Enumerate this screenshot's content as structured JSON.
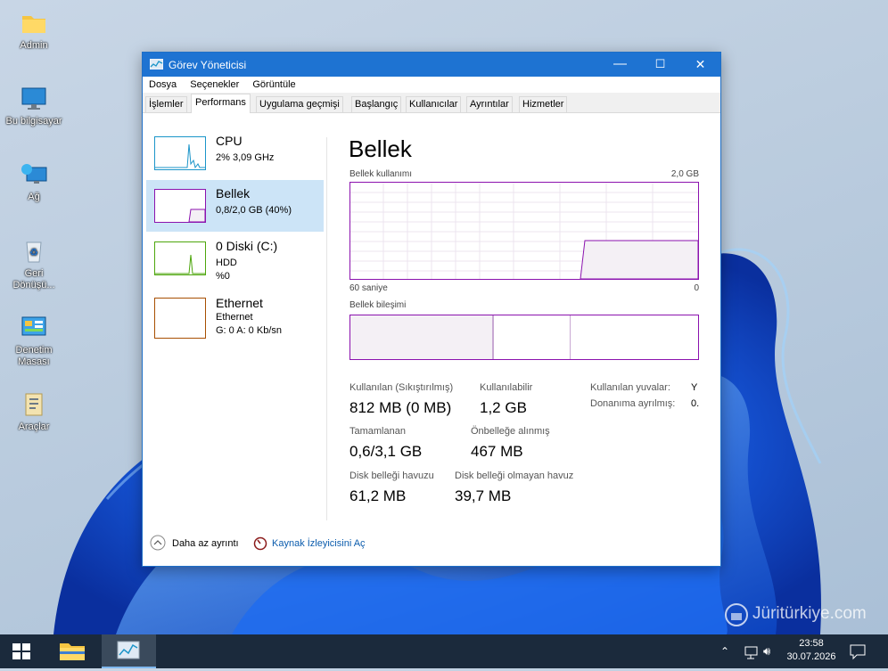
{
  "desktop": {
    "icons": [
      {
        "label": "Admin"
      },
      {
        "label": "Bu bilgisayar"
      },
      {
        "label": "Ağ"
      },
      {
        "label": "Geri Dönüşü..."
      },
      {
        "label": "Denetim Masası"
      },
      {
        "label": "Araçlar"
      }
    ],
    "watermark": "Jüritürkiye.com"
  },
  "window": {
    "title": "Görev Yöneticisi",
    "controls": {
      "minimize": "—",
      "maximize": "☐",
      "close": "✕"
    },
    "menu": [
      "Dosya",
      "Seçenekler",
      "Görüntüle"
    ],
    "tabs": [
      "İşlemler",
      "Performans",
      "Uygulama geçmişi",
      "Başlangıç",
      "Kullanıcılar",
      "Ayrıntılar",
      "Hizmetler"
    ],
    "active_tab": "Performans",
    "resources": [
      {
        "name": "CPU",
        "line1": "2% 3,09 GHz",
        "line2": "",
        "color": "#1b95c9"
      },
      {
        "name": "Bellek",
        "line1": "0,8/2,0 GB (40%)",
        "line2": "",
        "color": "#8b12ae",
        "selected": true
      },
      {
        "name": "0 Diski (C:)",
        "line1": "HDD",
        "line2": "%0",
        "color": "#4da60c"
      },
      {
        "name": "Ethernet",
        "line1": "Ethernet",
        "line2": "G: 0 A: 0 Kb/sn",
        "color": "#a74f01"
      }
    ],
    "memory": {
      "title": "Bellek",
      "usage_label": "Bellek kullanımı",
      "usage_max": "2,0 GB",
      "time_left": "60 saniye",
      "time_right": "0",
      "composition_label": "Bellek bileşimi",
      "usage_fraction": 0.4,
      "stats": {
        "in_use_label": "Kullanılan (Sıkıştırılmış)",
        "in_use_value": "812 MB (0 MB)",
        "available_label": "Kullanılabilir",
        "available_value": "1,2 GB",
        "committed_label": "Tamamlanan",
        "committed_value": "0,6/3,1 GB",
        "cached_label": "Önbelleğe alınmış",
        "cached_value": "467 MB",
        "paged_label": "Disk belleği havuzu",
        "paged_value": "61,2 MB",
        "nonpaged_label": "Disk belleği olmayan havuz",
        "nonpaged_value": "39,7 MB",
        "slots_label": "Kullanılan yuvalar:",
        "slots_value": "Y",
        "reserved_label": "Donanıma ayrılmış:",
        "reserved_value": "0."
      }
    },
    "footer": {
      "fewer_details": "Daha az ayrıntı",
      "resource_monitor": "Kaynak İzleyicisini Aç"
    }
  },
  "taskbar": {
    "time": "23:58",
    "date": "30.07.2026"
  }
}
